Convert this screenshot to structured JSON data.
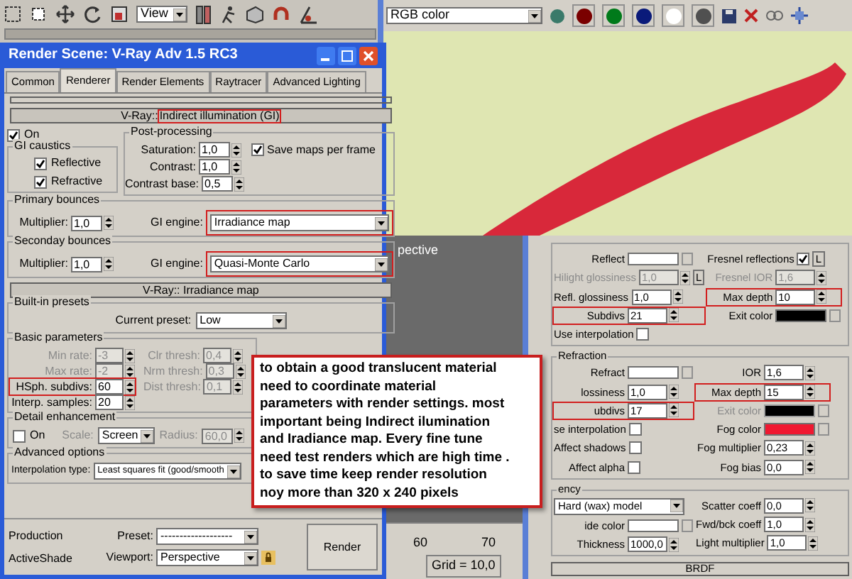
{
  "max_toolbar": {
    "view_dropdown": "View"
  },
  "frame_buffer": {
    "channel_dropdown": "RGB color",
    "channel_buttons": [
      {
        "color": "#7a0000"
      },
      {
        "color": "#007a1a"
      },
      {
        "color": "#0a1a7a"
      },
      {
        "color": "#ffffff"
      },
      {
        "color": "#505050"
      }
    ]
  },
  "render_dialog": {
    "title": "Render Scene: V-Ray Adv 1.5 RC3",
    "tabs": [
      {
        "label": "Common",
        "selected": false
      },
      {
        "label": "Renderer",
        "selected": true
      },
      {
        "label": "Render Elements",
        "selected": false
      },
      {
        "label": "Raytracer",
        "selected": false
      },
      {
        "label": "Advanced Lighting",
        "selected": false
      }
    ],
    "gi_rollout": {
      "prefix": "V-Ray::",
      "title": "Indirect illumination (GI)",
      "highlighted": true
    },
    "gi_on": {
      "label": "On",
      "checked": true
    },
    "gi_caustics": {
      "title": "GI caustics",
      "options": [
        {
          "label": "Reflective",
          "checked": true
        },
        {
          "label": "Refractive",
          "checked": true
        }
      ]
    },
    "post_processing": {
      "title": "Post-processing",
      "fields": [
        {
          "label": "Saturation:",
          "value": "1,0"
        },
        {
          "label": "Contrast:",
          "value": "1,0"
        },
        {
          "label": "Contrast base:",
          "value": "0,5"
        }
      ],
      "save_maps": {
        "label": "Save maps per frame",
        "checked": true
      }
    },
    "bounces": [
      {
        "title": "Primary bounces",
        "multiplier_label": "Multiplier:",
        "multiplier": "1,0",
        "engine_label": "GI engine:",
        "engine": "Irradiance map",
        "highlighted": true
      },
      {
        "title": "Seconday bounces",
        "multiplier_label": "Multiplier:",
        "multiplier": "1,0",
        "engine_label": "GI engine:",
        "engine": "Quasi-Monte Carlo",
        "highlighted": true
      }
    ],
    "irradiance_rollout": {
      "title": "V-Ray:: Irradiance map"
    },
    "presets": {
      "title": "Built-in presets",
      "label": "Current preset:",
      "value": "Low"
    },
    "basic_parameters": {
      "title": "Basic parameters",
      "left": [
        {
          "label": "Min rate:",
          "value": "-3",
          "disabled": true,
          "highlighted": false
        },
        {
          "label": "Max rate:",
          "value": "-2",
          "disabled": true,
          "highlighted": false
        },
        {
          "label": "HSph. subdivs:",
          "value": "60",
          "disabled": false,
          "highlighted": true
        },
        {
          "label": "Interp. samples:",
          "value": "20",
          "disabled": false,
          "highlighted": false
        }
      ],
      "right": [
        {
          "label": "Clr thresh:",
          "value": "0,4",
          "disabled": true,
          "highlighted": false
        },
        {
          "label": "Nrm thresh:",
          "value": "0,3",
          "disabled": true,
          "highlighted": false
        },
        {
          "label": "Dist thresh:",
          "value": "0,1",
          "disabled": true,
          "highlighted": false
        }
      ]
    },
    "detail_enhancement": {
      "title": "Detail enhancement",
      "on": {
        "label": "On",
        "checked": false
      },
      "scale_label": "Scale:",
      "scale": "Screen",
      "radius_label": "Radius:",
      "radius": "60,0"
    },
    "advanced_options": {
      "title": "Advanced options",
      "label": "Interpolation type:",
      "value": "Least squares fit (good/smooth"
    },
    "footer": {
      "modes": [
        "Production",
        "ActiveShade"
      ],
      "preset_label": "Preset:",
      "preset": "-------------------",
      "viewport_label": "Viewport:",
      "viewport": "Perspective",
      "render_button": "Render"
    }
  },
  "viewport": {
    "label": "pective",
    "ruler": [
      "60",
      "70"
    ],
    "grid": "Grid = 10,0"
  },
  "material_editor": {
    "sections": [
      {
        "left": [
          {
            "kind": "color",
            "label": "Reflect",
            "color": "#ffffff",
            "disabled": false,
            "highlighted": false
          },
          {
            "kind": "spinner",
            "label": "Hilight glossiness",
            "value": "1,0",
            "disabled": true,
            "highlighted": false,
            "lock": "L"
          },
          {
            "kind": "spinner",
            "label": "Refl. glossiness",
            "value": "1,0",
            "disabled": false,
            "highlighted": false
          },
          {
            "kind": "spinner",
            "label": "Subdivs",
            "value": "21",
            "disabled": false,
            "highlighted": true
          },
          {
            "kind": "check",
            "label": "Use interpolation",
            "checked": false
          }
        ],
        "right": [
          {
            "kind": "check",
            "label": "Fresnel reflections",
            "checked": true,
            "lock": "L"
          },
          {
            "kind": "spinner",
            "label": "Fresnel IOR",
            "value": "1,6",
            "disabled": true,
            "highlighted": false
          },
          {
            "kind": "spinner",
            "label": "Max depth",
            "value": "10",
            "disabled": false,
            "highlighted": true
          },
          {
            "kind": "color",
            "label": "Exit color",
            "color": "#000000",
            "disabled": false,
            "highlighted": false
          }
        ]
      },
      {
        "title": "Refraction",
        "left": [
          {
            "kind": "color",
            "label": "Refract",
            "color": "#ffffff",
            "disabled": false,
            "highlighted": false
          },
          {
            "kind": "spinner",
            "label": "lossiness",
            "value": "1,0",
            "disabled": false,
            "highlighted": false
          },
          {
            "kind": "spinner",
            "label": "ubdivs",
            "value": "17",
            "disabled": false,
            "highlighted": true
          },
          {
            "kind": "check",
            "label": "se interpolation",
            "checked": false
          },
          {
            "kind": "check",
            "label": "Affect shadows",
            "checked": false
          },
          {
            "kind": "check",
            "label": "Affect alpha",
            "checked": false
          }
        ],
        "right": [
          {
            "kind": "spinner",
            "label": "IOR",
            "value": "1,6",
            "disabled": false,
            "highlighted": false
          },
          {
            "kind": "spinner",
            "label": "Max depth",
            "value": "15",
            "disabled": false,
            "highlighted": true
          },
          {
            "kind": "color",
            "label": "Exit color",
            "color": "#000000",
            "disabled": true,
            "highlighted": false
          },
          {
            "kind": "color",
            "label": "Fog color",
            "color": "#f01830",
            "disabled": false,
            "highlighted": false
          },
          {
            "kind": "spinner",
            "label": "Fog multiplier",
            "value": "0,23",
            "disabled": false,
            "highlighted": false
          },
          {
            "kind": "spinner",
            "label": "Fog bias",
            "value": "0,0",
            "disabled": false,
            "highlighted": false
          }
        ]
      },
      {
        "title": "ency",
        "left": [
          {
            "kind": "dropdown",
            "value": "Hard (wax) model"
          },
          {
            "kind": "color",
            "label": "ide color",
            "color": "#ffffff",
            "disabled": false,
            "highlighted": false
          },
          {
            "kind": "spinner",
            "label": "Thickness",
            "value": "1000,0",
            "disabled": false,
            "highlighted": false
          }
        ],
        "right": [
          {
            "kind": "spinner",
            "label": "Scatter coeff",
            "value": "0,0",
            "disabled": false,
            "highlighted": false
          },
          {
            "kind": "spinner",
            "label": "Fwd/bck coeff",
            "value": "1,0",
            "disabled": false,
            "highlighted": false
          },
          {
            "kind": "spinner",
            "label": "Light multiplier",
            "value": "1,0",
            "disabled": false,
            "highlighted": false
          }
        ]
      }
    ],
    "brdf_rollout": "BRDF"
  },
  "callout": {
    "lines": [
      "to obtain a good translucent material",
      "need to coordinate material",
      "parameters with render settings. most",
      "important being Indirect ilumination",
      "and Iradiance map.  Every fine tune",
      "need test renders which are high time .",
      "to save time keep render resolution",
      "noy more than 320 x 240 pixels"
    ]
  }
}
